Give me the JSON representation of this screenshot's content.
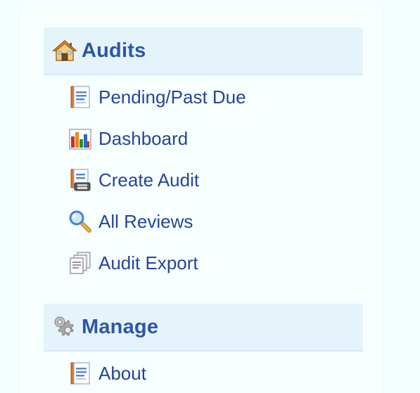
{
  "sections": [
    {
      "title": "Audits",
      "icon": "home-icon",
      "items": [
        {
          "label": "Pending/Past Due",
          "icon": "document-icon"
        },
        {
          "label": "Dashboard",
          "icon": "bar-chart-icon"
        },
        {
          "label": "Create Audit",
          "icon": "create-document-icon"
        },
        {
          "label": "All Reviews",
          "icon": "magnifier-icon"
        },
        {
          "label": "Audit Export",
          "icon": "copy-documents-icon"
        }
      ]
    },
    {
      "title": "Manage",
      "icon": "gear-icon",
      "items": [
        {
          "label": "About",
          "icon": "document-icon"
        }
      ]
    }
  ],
  "colors": {
    "page_background": "#f4feff",
    "header_background": "#e5f4fb",
    "header_text": "#2d57a6",
    "link_text": "#24459b"
  }
}
